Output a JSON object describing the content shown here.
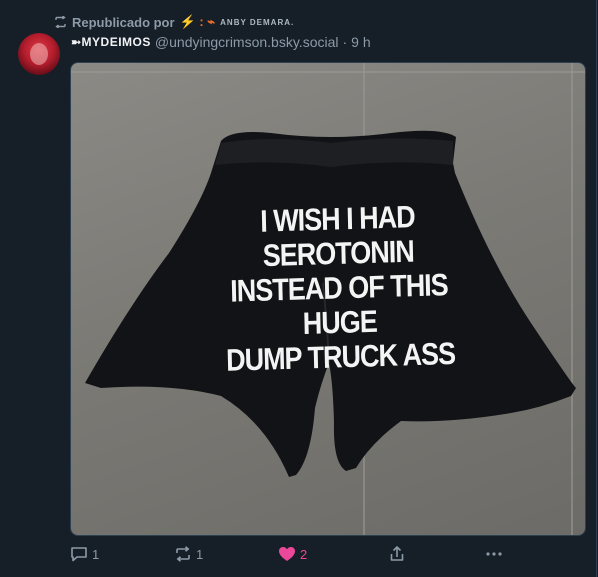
{
  "repost": {
    "label": "Republicado por",
    "name_prefix": "⚡ : ⌁",
    "name": "ANBY DEMARA."
  },
  "author": {
    "display_name": "➼MYDEIMOS",
    "handle": "@undyingcrimson.bsky.social",
    "separator": "·",
    "time": "9 h"
  },
  "image": {
    "alt": "Black shorts with printed text",
    "shirt_text": [
      "I WISH I HAD SEROTONIN",
      "INSTEAD OF THIS HUGE",
      "DUMP TRUCK ASS"
    ]
  },
  "actions": {
    "reply_count": "1",
    "repost_count": "1",
    "like_count": "2"
  },
  "colors": {
    "background": "#161e27",
    "muted": "#8d9aa8",
    "like": "#ec4899",
    "accent_bolt": "#f5702a"
  },
  "icons": [
    "repost-icon",
    "reply-icon",
    "like-icon",
    "share-icon",
    "more-icon"
  ]
}
